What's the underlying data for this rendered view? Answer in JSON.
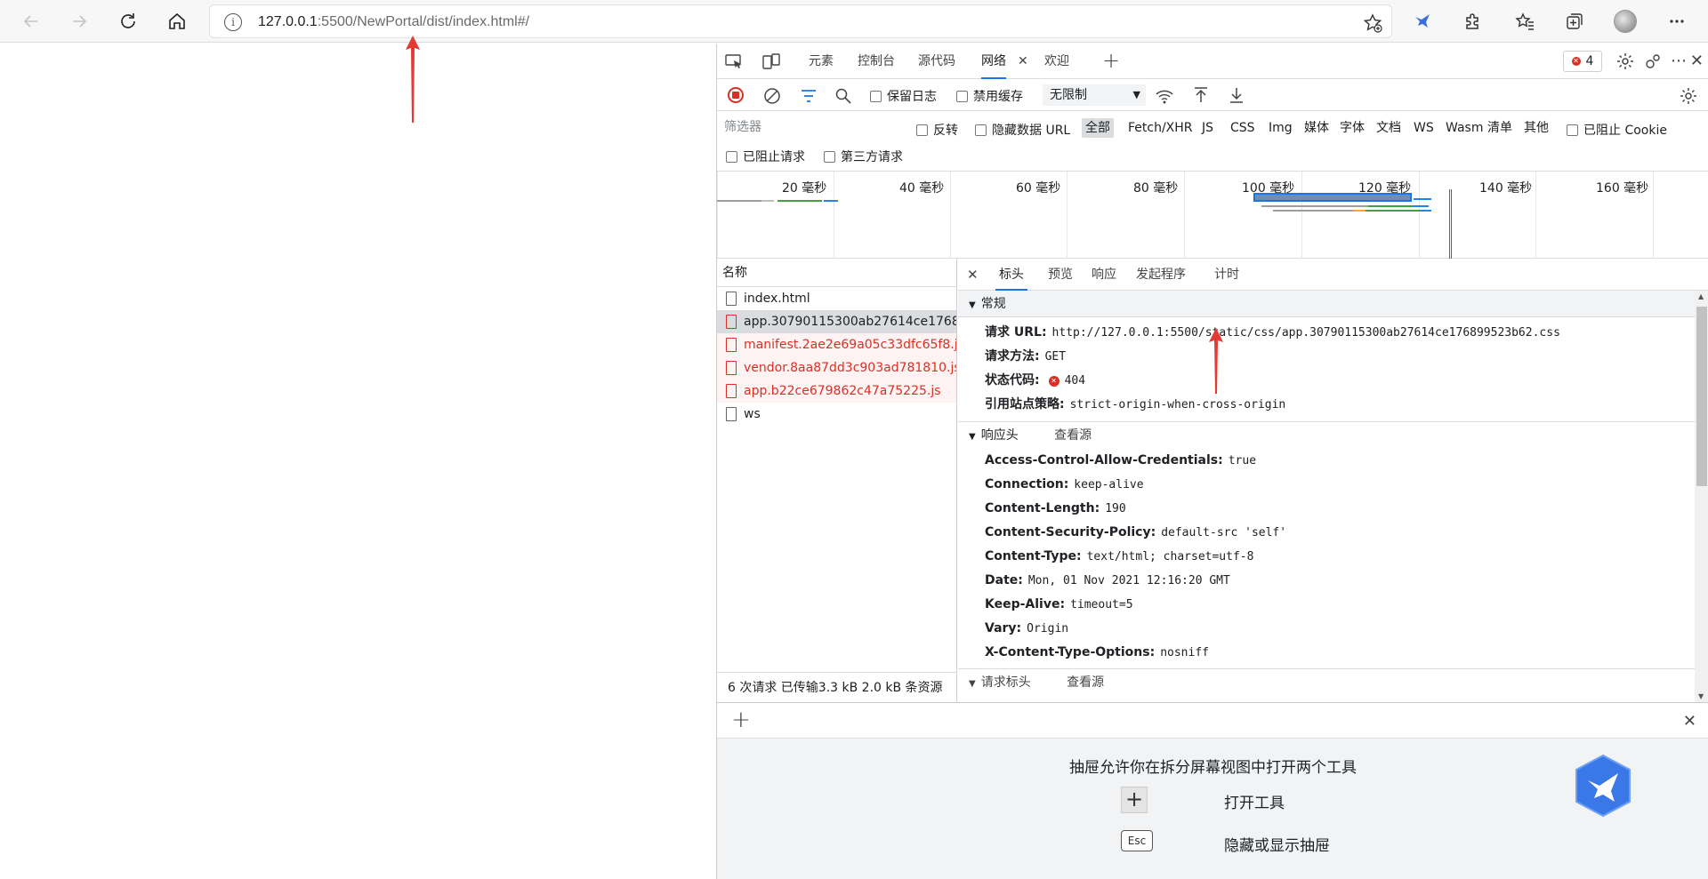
{
  "browser": {
    "url_host": "127.0.0.1",
    "url_path": ":5500/NewPortal/dist/index.html#/"
  },
  "devtools": {
    "tabs": [
      "元素",
      "控制台",
      "源代码",
      "网络",
      "欢迎"
    ],
    "active_tab": "网络",
    "error_count": "4",
    "toolbar": {
      "preserve_log": "保留日志",
      "disable_cache": "禁用缓存",
      "throttle": "无限制"
    },
    "filter": {
      "placeholder": "筛选器",
      "invert": "反转",
      "hide_data_urls": "隐藏数据 URL",
      "types": [
        "全部",
        "Fetch/XHR",
        "JS",
        "CSS",
        "Img",
        "媒体",
        "字体",
        "文档",
        "WS",
        "Wasm",
        "清单",
        "其他"
      ],
      "blocked_cookies": "已阻止 Cookie",
      "blocked_requests": "已阻止请求",
      "third_party": "第三方请求"
    },
    "timeline": {
      "ticks": [
        "20 毫秒",
        "40 毫秒",
        "60 毫秒",
        "80 毫秒",
        "100 毫秒",
        "120 毫秒",
        "140 毫秒",
        "160 毫秒"
      ]
    },
    "list": {
      "header": "名称",
      "rows": [
        {
          "name": "index.html",
          "status": "ok"
        },
        {
          "name": "app.30790115300ab27614ce1768...",
          "status": "selected"
        },
        {
          "name": "manifest.2ae2e69a05c33dfc65f8.js",
          "status": "error"
        },
        {
          "name": "vendor.8aa87dd3c903ad781810.js",
          "status": "error"
        },
        {
          "name": "app.b22ce679862c47a75225.js",
          "status": "error"
        },
        {
          "name": "ws",
          "status": "ok"
        }
      ],
      "footer": "6 次请求   已传输3.3 kB   2.0 kB 条资源"
    },
    "detail": {
      "tabs": [
        "标头",
        "预览",
        "响应",
        "发起程序",
        "计时"
      ],
      "general_title": "常规",
      "general": [
        {
          "k": "请求 URL:",
          "v": "http://127.0.0.1:5500/static/css/app.30790115300ab27614ce176899523b62.css"
        },
        {
          "k": "请求方法:",
          "v": "GET"
        },
        {
          "k": "状态代码:",
          "v": "404"
        },
        {
          "k": "引用站点策略:",
          "v": "strict-origin-when-cross-origin"
        }
      ],
      "response_title": "响应头",
      "view_source": "查看源",
      "response": [
        {
          "k": "Access-Control-Allow-Credentials:",
          "v": "true"
        },
        {
          "k": "Connection:",
          "v": "keep-alive"
        },
        {
          "k": "Content-Length:",
          "v": "190"
        },
        {
          "k": "Content-Security-Policy:",
          "v": "default-src 'self'"
        },
        {
          "k": "Content-Type:",
          "v": "text/html; charset=utf-8"
        },
        {
          "k": "Date:",
          "v": "Mon, 01 Nov 2021 12:16:20 GMT"
        },
        {
          "k": "Keep-Alive:",
          "v": "timeout=5"
        },
        {
          "k": "Vary:",
          "v": "Origin"
        },
        {
          "k": "X-Content-Type-Options:",
          "v": "nosniff"
        }
      ],
      "request_title": "请求标头"
    },
    "drawer": {
      "message": "抽屉允许你在拆分屏幕视图中打开两个工具",
      "open_tool": "打开工具",
      "toggle": "隐藏或显示抽屉",
      "esc": "Esc"
    }
  }
}
